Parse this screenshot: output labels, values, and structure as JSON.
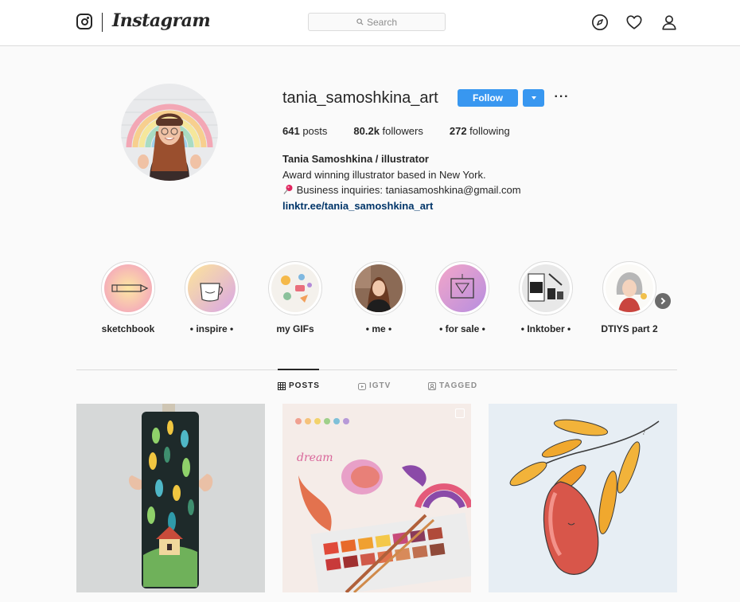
{
  "nav": {
    "wordmark": "Instagram",
    "search_placeholder": "Search",
    "icons": [
      "compass-icon",
      "heart-icon",
      "user-icon"
    ]
  },
  "profile": {
    "username": "tania_samoshkina_art",
    "follow_label": "Follow",
    "more_label": "···",
    "stats": {
      "posts_count": "641",
      "posts_label": " posts",
      "followers_count": "80.2k",
      "followers_label": " followers",
      "following_count": "272",
      "following_label": " following"
    },
    "bio": {
      "full_name": "Tania Samoshkina / illustrator",
      "line1": "Award winning illustrator based in New York.",
      "line2": "Business inquiries: taniasamoshkina@gmail.com",
      "link": "linktr.ee/tania_samoshkina_art"
    }
  },
  "highlights": [
    {
      "label": "sketchbook"
    },
    {
      "label": "• inspire •"
    },
    {
      "label": "my GIFs"
    },
    {
      "label": "• me •"
    },
    {
      "label": "• for sale •"
    },
    {
      "label": "• Inktober •"
    },
    {
      "label": "DTIYS part 2"
    }
  ],
  "tabs": [
    {
      "label": "POSTS",
      "active": true
    },
    {
      "label": "IGTV",
      "active": false
    },
    {
      "label": "TAGGED",
      "active": false
    }
  ],
  "colors": {
    "accent": "#3897f0",
    "link": "#003569",
    "border": "#dbdbdb",
    "text": "#262626",
    "muted": "#8e8e8e"
  }
}
